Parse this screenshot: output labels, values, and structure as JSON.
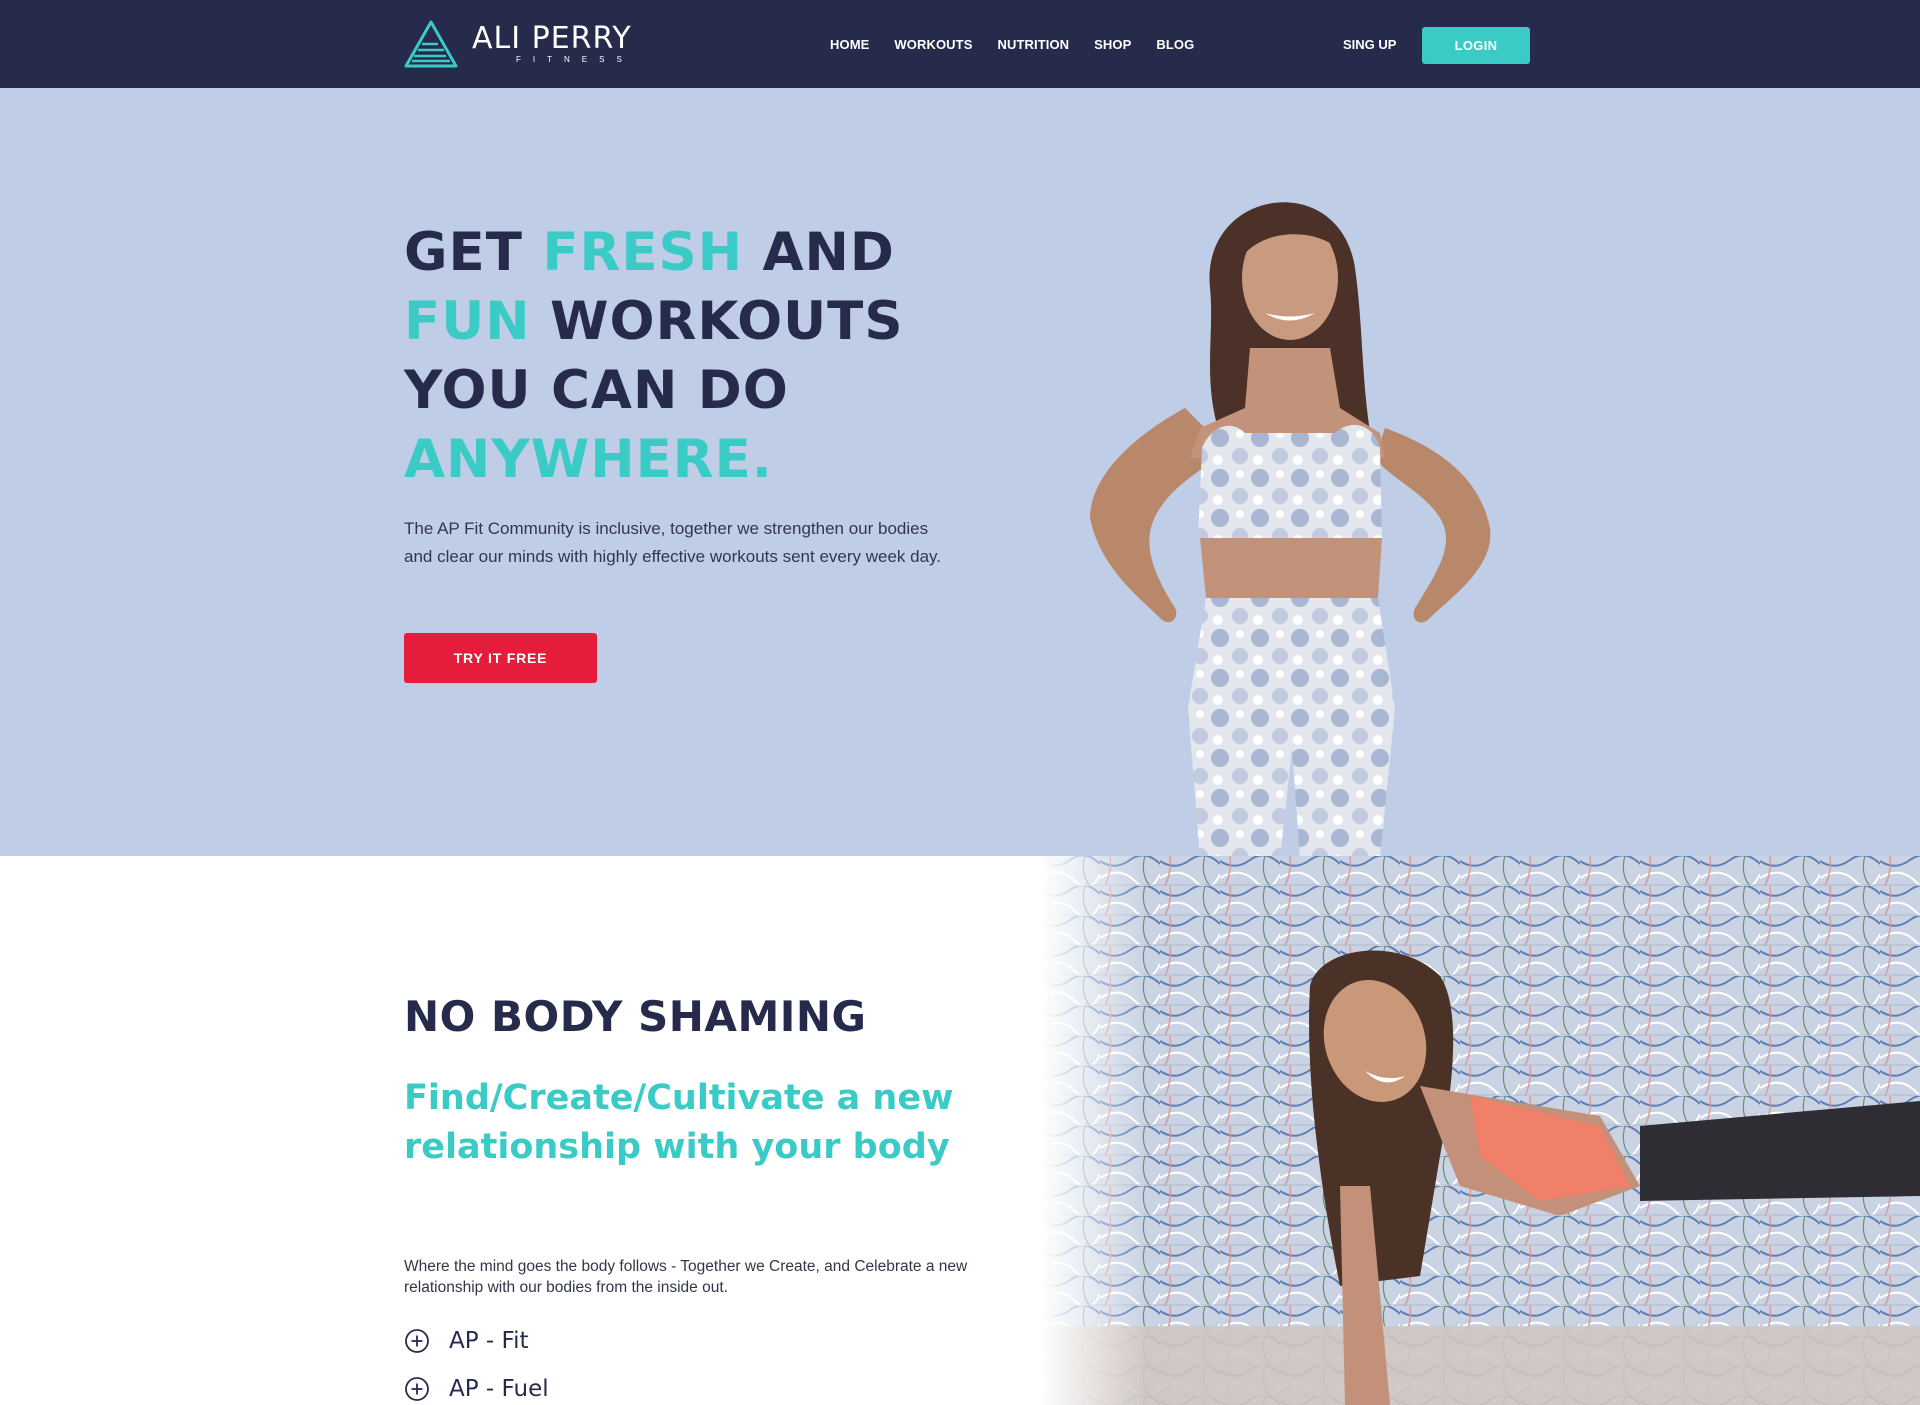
{
  "brand": {
    "name": "ALI PERRY",
    "tagline": "FITNESS",
    "accent_color": "#3bcbc6",
    "navy": "#272b4b"
  },
  "nav": {
    "items": [
      {
        "label": "HOME"
      },
      {
        "label": "WORKOUTS"
      },
      {
        "label": "NUTRITION"
      },
      {
        "label": "SHOP"
      },
      {
        "label": "BLOG"
      }
    ],
    "signup_label": "SING UP",
    "login_label": "LOGIN"
  },
  "hero": {
    "title_parts": [
      "GET ",
      "FRESH",
      " AND",
      "FUN",
      " WORKOUTS",
      "YOU CAN DO",
      "ANYWHERE."
    ],
    "description": "The AP Fit Community is inclusive, together we strengthen our bodies and clear our minds with highly effective workouts sent every week day.",
    "cta_label": "TRY IT FREE",
    "cta_color": "#e61d3a",
    "background": "#c0cde6"
  },
  "section2": {
    "title": "NO BODY SHAMING",
    "subtitle": "Find/Create/Cultivate a new relationship with your body",
    "description": "Where the mind goes the body follows - Together we Create, and Celebrate a new relationship with our bodies from the inside out.",
    "accordion": [
      {
        "label": "AP - Fit",
        "icon": "plus-circle-icon"
      },
      {
        "label": "AP - Fuel",
        "icon": "plus-circle-icon"
      }
    ]
  }
}
